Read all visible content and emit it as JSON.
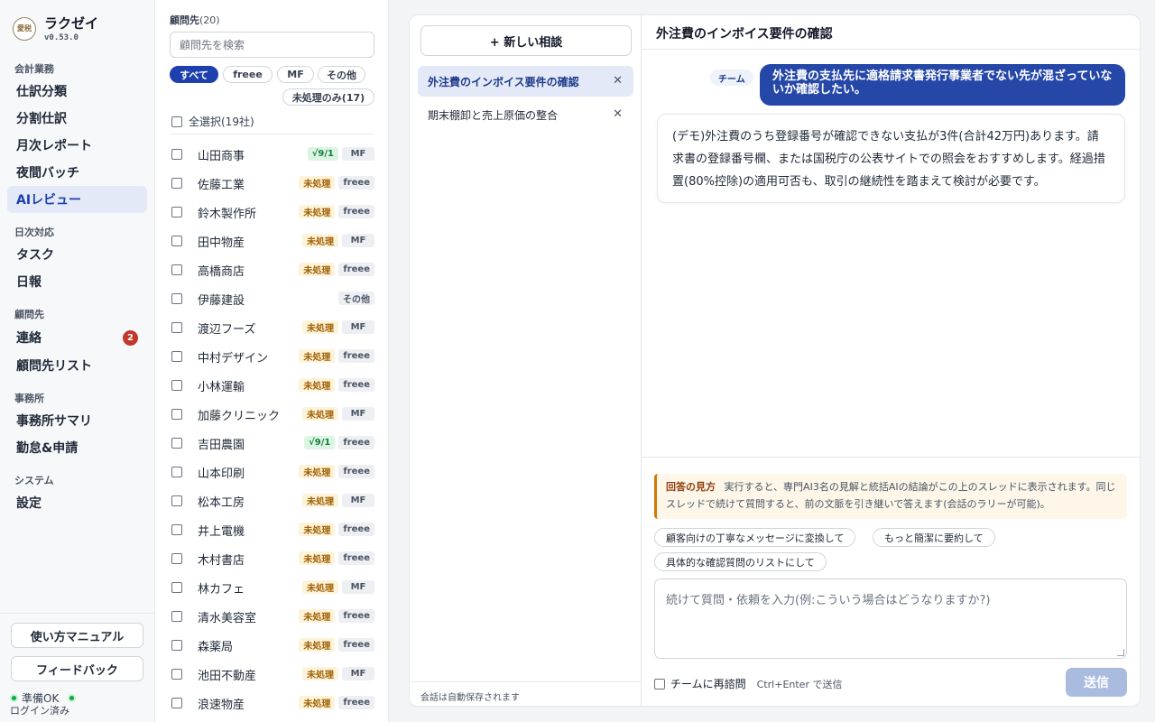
{
  "brand": {
    "logo_text": "愛税",
    "name": "ラクゼイ",
    "version": "v0.53.0"
  },
  "nav": {
    "groups": [
      {
        "label": "会計業務",
        "items": [
          "仕訳分類",
          "分割仕訳",
          "月次レポート",
          "夜間バッチ",
          "AIレビュー"
        ]
      },
      {
        "label": "日次対応",
        "items": [
          "タスク",
          "日報"
        ]
      },
      {
        "label": "顧問先",
        "items": [
          "連絡",
          "顧問先リスト"
        ]
      },
      {
        "label": "事務所",
        "items": [
          "事務所サマリ",
          "勤怠&申請"
        ]
      },
      {
        "label": "システム",
        "items": [
          "設定"
        ]
      }
    ],
    "active": "AIレビュー",
    "contact_badge": "2"
  },
  "sidebar_bottom": {
    "manual_label": "使い方マニュアル",
    "feedback_label": "フィードバック",
    "status": "準備OK",
    "login": "ログイン済み"
  },
  "clients": {
    "title": "顧問先",
    "count": "(20)",
    "search_placeholder": "顧問先を検索",
    "filters": [
      "すべて",
      "freee",
      "MF",
      "その他"
    ],
    "active_filter": "すべて",
    "unprocessed_filter": "未処理のみ(17)",
    "select_all": "全選択(19社)",
    "rows": [
      {
        "name": "山田商事",
        "status": "√9/1",
        "status_kind": "done",
        "source": "MF"
      },
      {
        "name": "佐藤工業",
        "status": "未処理",
        "status_kind": "pending",
        "source": "freee"
      },
      {
        "name": "鈴木製作所",
        "status": "未処理",
        "status_kind": "pending",
        "source": "freee"
      },
      {
        "name": "田中物産",
        "status": "未処理",
        "status_kind": "pending",
        "source": "MF"
      },
      {
        "name": "高橋商店",
        "status": "未処理",
        "status_kind": "pending",
        "source": "freee"
      },
      {
        "name": "伊藤建設",
        "status": "",
        "status_kind": "none",
        "source": "その他"
      },
      {
        "name": "渡辺フーズ",
        "status": "未処理",
        "status_kind": "pending",
        "source": "MF"
      },
      {
        "name": "中村デザイン",
        "status": "未処理",
        "status_kind": "pending",
        "source": "freee"
      },
      {
        "name": "小林運輸",
        "status": "未処理",
        "status_kind": "pending",
        "source": "freee"
      },
      {
        "name": "加藤クリニック",
        "status": "未処理",
        "status_kind": "pending",
        "source": "MF"
      },
      {
        "name": "吉田農園",
        "status": "√9/1",
        "status_kind": "done",
        "source": "freee"
      },
      {
        "name": "山本印刷",
        "status": "未処理",
        "status_kind": "pending",
        "source": "freee"
      },
      {
        "name": "松本工房",
        "status": "未処理",
        "status_kind": "pending",
        "source": "MF"
      },
      {
        "name": "井上電機",
        "status": "未処理",
        "status_kind": "pending",
        "source": "freee"
      },
      {
        "name": "木村書店",
        "status": "未処理",
        "status_kind": "pending",
        "source": "freee"
      },
      {
        "name": "林カフェ",
        "status": "未処理",
        "status_kind": "pending",
        "source": "MF"
      },
      {
        "name": "清水美容室",
        "status": "未処理",
        "status_kind": "pending",
        "source": "freee"
      },
      {
        "name": "森薬局",
        "status": "未処理",
        "status_kind": "pending",
        "source": "freee"
      },
      {
        "name": "池田不動産",
        "status": "未処理",
        "status_kind": "pending",
        "source": "MF"
      },
      {
        "name": "浪速物産",
        "status": "未処理",
        "status_kind": "pending",
        "source": "freee"
      }
    ]
  },
  "threads": {
    "new_label": "+ 新しい相談",
    "items": [
      "外注費のインボイス要件の確認",
      "期末棚卸と売上原価の整合"
    ],
    "active_index": 0,
    "autosave": "会話は自動保存されます"
  },
  "chat": {
    "title": "外注費のインボイス要件の確認",
    "team_label": "チーム",
    "user_message": "外注費の支払先に適格請求書発行事業者でない先が混ざっていないか確認したい。",
    "ai_message": "(デモ)外注費のうち登録番号が確認できない支払が3件(合計42万円)あります。請求書の登録番号欄、または国税庁の公表サイトでの照会をおすすめします。経過措置(80%控除)の適用可否も、取引の継続性を踏まえて検討が必要です。"
  },
  "composer": {
    "hint_title": "回答の見方",
    "hint_body": "実行すると、専門AI3名の見解と統括AIの結論がこの上のスレッドに表示されます。同じスレッドで続けて質問すると、前の文脈を引き継いで答えます(会話のラリーが可能)。",
    "suggestions": [
      "顧客向けの丁寧なメッセージに変換して",
      "もっと簡潔に要約して",
      "具体的な確認質問のリストにして"
    ],
    "placeholder": "続けて質問・依頼を入力(例:こういう場合はどうなりますか?)",
    "reask_label": "チームに再諮問",
    "shortcut": "Ctrl+Enter で送信",
    "send_label": "送信"
  },
  "colors": {
    "accent": "#1e40af",
    "user_bubble": "#2547a8",
    "badge": "#c0392b",
    "status_ok": "#16a34a",
    "hint_border": "#d97706"
  }
}
